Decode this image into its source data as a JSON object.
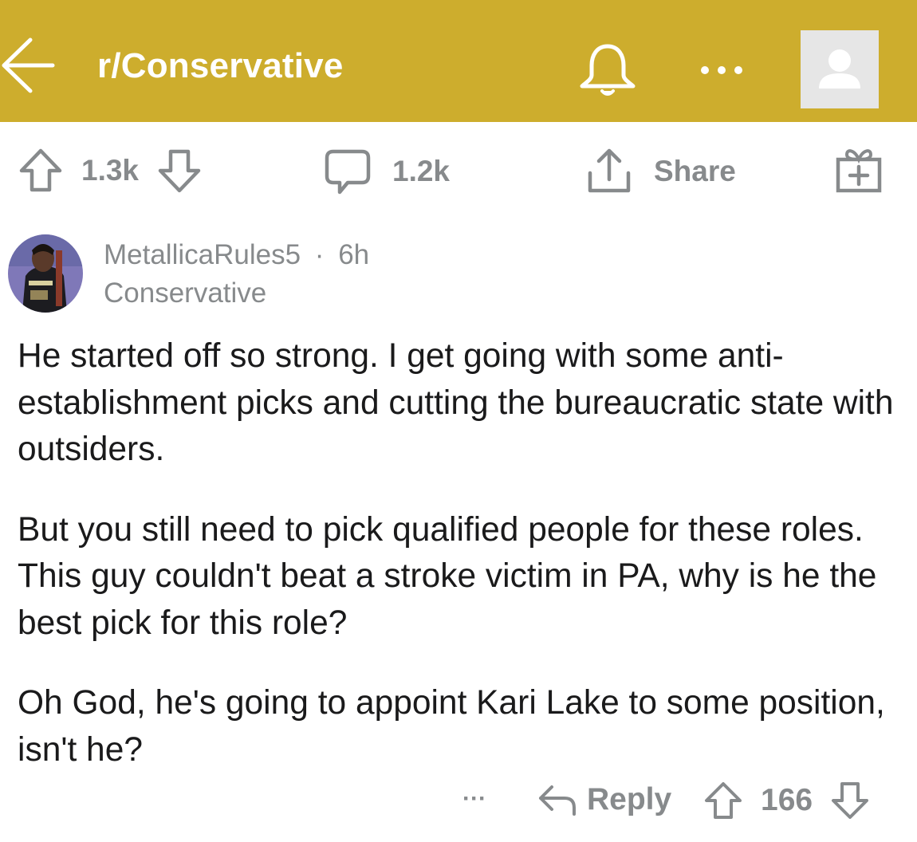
{
  "header": {
    "title": "r/Conservative",
    "background_color": "#cdad2d",
    "icons": [
      "back-arrow-icon",
      "bell-icon",
      "more-dots-icon",
      "user-avatar-icon"
    ]
  },
  "post_actions": {
    "upvotes": "1.3k",
    "comments": "1.2k",
    "share_label": "Share",
    "icons": [
      "upvote-icon",
      "downvote-icon",
      "comment-icon",
      "share-icon",
      "gift-icon"
    ]
  },
  "comment": {
    "author": "MetallicaRules5",
    "separator": "·",
    "age": "6h",
    "flair": "Conservative",
    "paragraphs": [
      "He started off so strong. I get going with some anti-establishment picks and cutting the bureaucratic state with outsiders.",
      "But you still need to pick qualified people for these roles. This guy couldn't beat a stroke victim in PA, why is he the best pick for this role?",
      "Oh God, he's going to appoint Kari Lake to some position, isn't he?"
    ],
    "more_label": "···",
    "reply_label": "Reply",
    "score": "166"
  },
  "colors": {
    "muted_text": "#878a8c",
    "body_text": "#1a1a1b",
    "avatar_placeholder": "#e6e6e6"
  }
}
